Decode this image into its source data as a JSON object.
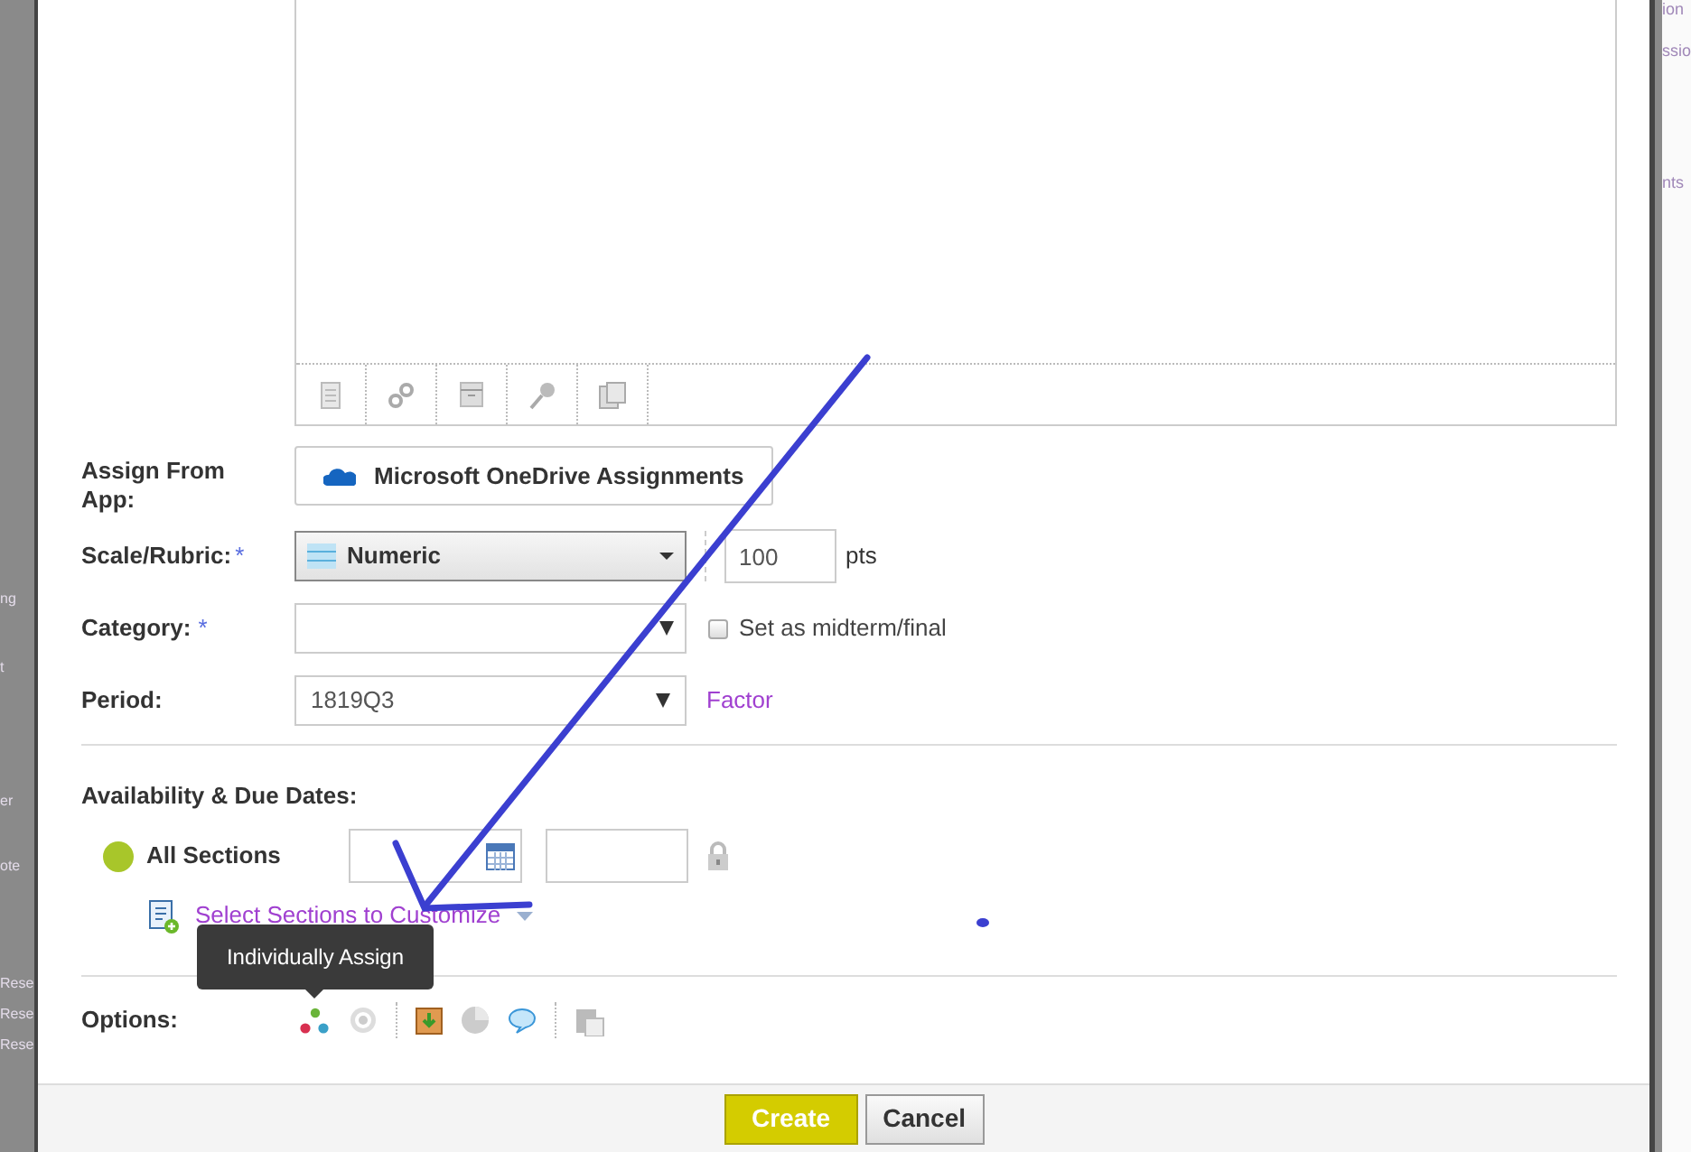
{
  "background": {
    "left_fragments": [
      "ng",
      "t",
      "er",
      "ote",
      "Rese",
      "Rese",
      "Rese"
    ],
    "right_fragments": [
      "ion",
      "ssio",
      "nts"
    ]
  },
  "form": {
    "assign_from_app": {
      "label": "Assign From App:",
      "button": "Microsoft OneDrive Assignments"
    },
    "scale": {
      "label": "Scale/Rubric:",
      "required_mark": "*",
      "value": "Numeric",
      "points": "100",
      "unit": "pts"
    },
    "category": {
      "label": "Category:",
      "required_mark": "*",
      "checkbox": {
        "label": "Set as midterm/final",
        "checked": false
      }
    },
    "period": {
      "label": "Period:",
      "value": "1819Q3",
      "link": "Factor"
    }
  },
  "availability": {
    "heading": "Availability & Due Dates:",
    "sections": [
      {
        "label": "All Sections"
      }
    ],
    "customize_link": "Select Sections to Customize"
  },
  "options": {
    "label": "Options:",
    "tooltip": "Individually Assign"
  },
  "buttons": [
    {
      "label": "Create",
      "kind": "primary"
    },
    {
      "label": "Cancel",
      "kind": "secondary"
    }
  ]
}
